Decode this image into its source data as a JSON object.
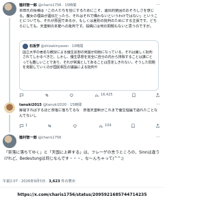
{
  "tweets": [
    {
      "name": "植村智一郎",
      "handle": "@charis1756",
      "time": "15時間",
      "text": "本田氏の投稿は「この人たちを狂にするためにこそ、遺伝的要因のおそろしさを感じる。魔女の理由が遺伝だったら、それはそれで構わないというわけではない」ということについても、それが原因であるか、もしくは差別の批判のためにする主張です。どちらにしても、天皇制の本筋への批判です。投稿には何の問題もないと思うのですが。",
      "quote": {
        "name": "石坂学",
        "handle": "@shizakinyaoon",
        "time": "10時間",
        "text": "国立大学の著名な教授による優生思想の発露が問題になっている。それは厳しく批判されてしかるべきだ。しかし、優生思想を完全に自分の内から排除することは誰にとっても難しいことであり、それが常識としてあることは否定しきれない。そうした問題を克服していくのが国民相互の議論による批判や"
      },
      "actions": {
        "reply": "",
        "retweet": "",
        "like": "",
        "views": "16,425"
      }
    },
    {
      "name": "tanuki2015",
      "handle": "@tanuki2020",
      "time": "15時間",
      "text": "揶揄すればするほど奈落に落ちてるな　奈落天皇制がこれまで優生理論で語れたことなんてないし",
      "actions": {
        "reply": "1",
        "retweet": "",
        "like": "",
        "views": "104"
      }
    },
    {
      "name": "植村智一郎",
      "handle": "@charis1756",
      "time": "15時間",
      "text": "「奈落に落ちてゆく」と「天国に上昇する」は、フレーゲの言うところの、Sinnは違うけれど、Bedeutungは同じなんです・・・、な〜んちゃって(^^;)",
      "actions": {
        "reply": "",
        "retweet": "",
        "like": "",
        "views": ""
      }
    }
  ],
  "footer": {
    "timestamp": "午前2:07 · 2026年9月5日 ·",
    "views_count": "3,623",
    "views_label": "件の表示",
    "url": "https://x.com/charis1756/status/2095921685744714235"
  }
}
